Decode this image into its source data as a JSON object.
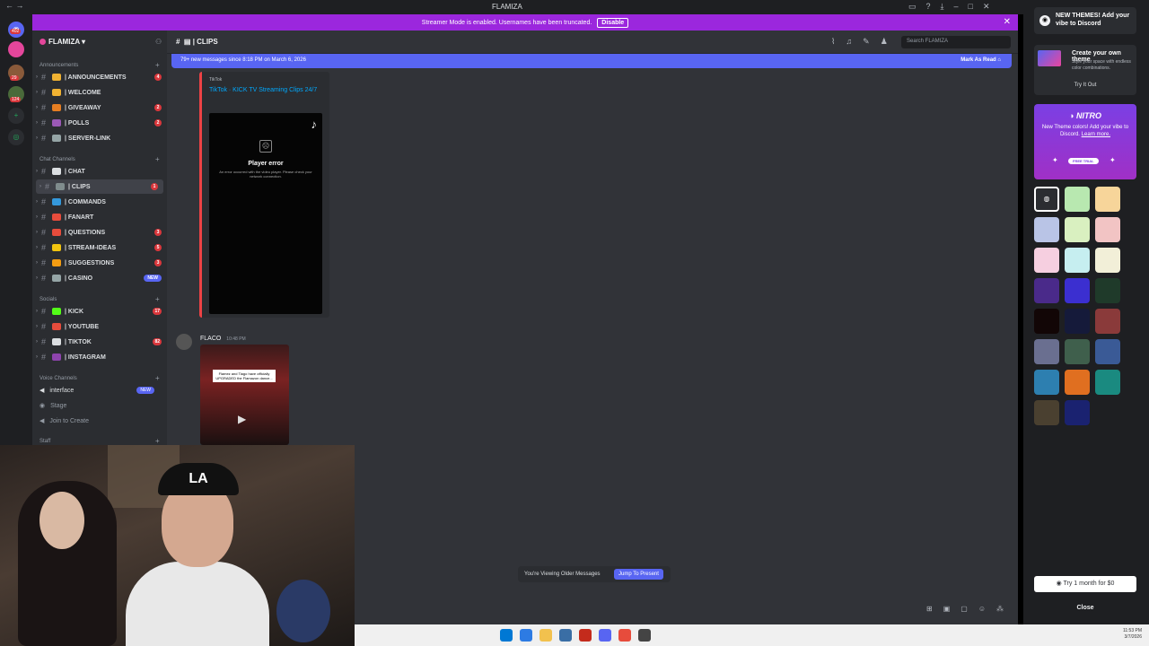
{
  "window": {
    "title": "FLAMIZA"
  },
  "banner": {
    "text": "Streamer Mode is enabled. Usernames have been truncated.",
    "disable_label": "Disable"
  },
  "rail": {
    "badges": [
      "402",
      "29",
      "124"
    ]
  },
  "server": {
    "name": "FLAMIZA"
  },
  "categories": {
    "announcements": "Announcements",
    "chat": "Chat Channels",
    "socials": "Socials",
    "voice": "Voice Channels",
    "staff": "Staff"
  },
  "channels": [
    {
      "name": "| ANNOUNCEMENTS",
      "badge": "4",
      "color": "#f0b232"
    },
    {
      "name": "| WELCOME",
      "badge": "",
      "color": "#f0b232"
    },
    {
      "name": "| GIVEAWAY",
      "badge": "2",
      "color": "#e67e22"
    },
    {
      "name": "| POLLS",
      "badge": "2",
      "color": "#9b59b6"
    },
    {
      "name": "| SERVER-LINK",
      "badge": "",
      "color": "#95a5a6"
    },
    {
      "name": "| CHAT",
      "badge": "",
      "color": "#dbdee1"
    },
    {
      "name": "| CLIPS",
      "badge": "1",
      "color": "#7f8c8d"
    },
    {
      "name": "| COMMANDS",
      "badge": "",
      "color": "#3498db"
    },
    {
      "name": "| FANART",
      "badge": "",
      "color": "#e74c3c"
    },
    {
      "name": "| QUESTIONS",
      "badge": "3",
      "color": "#e74c3c"
    },
    {
      "name": "| STREAM-IDEAS",
      "badge": "5",
      "color": "#f1c40f"
    },
    {
      "name": "| SUGGESTIONS",
      "badge": "3",
      "color": "#f39c12"
    },
    {
      "name": "| CASINO",
      "badge": "NEW",
      "color": "#95a5a6"
    },
    {
      "name": "| KICK",
      "badge": "17",
      "color": "#53fc18"
    },
    {
      "name": "| YOUTUBE",
      "badge": "",
      "color": "#e74c3c"
    },
    {
      "name": "| TIKTOK",
      "badge": "82",
      "color": "#dbdee1"
    },
    {
      "name": "| INSTAGRAM",
      "badge": "",
      "color": "#8e44ad"
    }
  ],
  "voice": {
    "interface": "interface",
    "interface_badge": "NEW",
    "stage": "Stage",
    "join": "Join to Create"
  },
  "main": {
    "channel_title": "| CLIPS",
    "search_placeholder": "Search FLAMIZA",
    "new_messages": "79+ new messages since 8:18 PM on March 6, 2026",
    "mark_read": "Mark As Read",
    "embed": {
      "provider": "TikTok",
      "title": "TikTok · KICK TV Streaming Clips 24/7",
      "error_title": "Player error",
      "error_text": "An error occurred with the video player. Please check your network connection."
    },
    "message2": {
      "author": "FLACO",
      "time": "10:48 PM",
      "caption": "Flamez and Tiago have officially UPGRADED the Flamazon dance..."
    },
    "older": "You're Viewing Older Messages",
    "jump": "Jump To Present"
  },
  "right_panel": {
    "head": "NEW THEMES! Add your vibe to Discord",
    "own_title": "Create your own theme",
    "own_text": "Style your space with endless color combinations.",
    "try_out": "Try It Out",
    "nitro_logo": "NITRO",
    "nitro_text": "New Theme colors! Add your vibe to Discord.",
    "learn_more": "Learn more.",
    "free_trial": "FREE TRIAL",
    "swatches": [
      "#2b2d31",
      "#b8e8b0",
      "#f7d59a",
      "#b9c4e6",
      "#d9f0c0",
      "#f2c4c4",
      "#f6cfe0",
      "#c6eef0",
      "#f2efd8",
      "#4a2a8a",
      "#3b2fd0",
      "#1f3a2a",
      "#120606",
      "#151a3a",
      "#8a3a3a",
      "#6a6f90",
      "#3f5f4c",
      "#3a5a96",
      "#2d7fb0",
      "#e06f20",
      "#1a8a80",
      "#4a4030",
      "#1a2270"
    ],
    "try_month": "Try 1 month for $0",
    "close": "Close"
  },
  "taskbar": {
    "time": "11:53 PM",
    "date": "3/7/2026",
    "apps": [
      "#0078d4",
      "#2d7be3",
      "#f2c14e",
      "#3a6ea5",
      "#c42b1c",
      "#5865f2",
      "#e74c3c",
      "#444444"
    ]
  }
}
